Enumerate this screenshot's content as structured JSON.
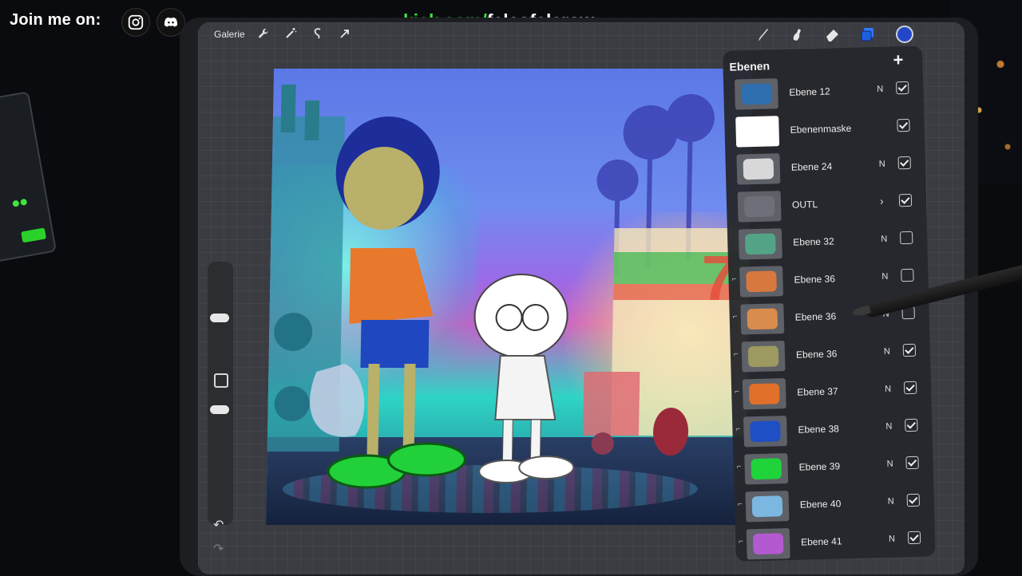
{
  "overlay": {
    "join_text": "Join me on:",
    "socials": [
      {
        "icon": "instagram-icon"
      },
      {
        "icon": "discord-icon"
      }
    ],
    "url_green": "kick.com/",
    "url_white": "falcofalcrow"
  },
  "toolbar": {
    "gallery_label": "Galerie",
    "left_tools": [
      "wrench-icon",
      "magic-wand-icon",
      "selection-icon",
      "transform-arrow-icon"
    ],
    "right_tools": [
      "brush-icon",
      "smudge-icon",
      "eraser-icon",
      "layers-icon"
    ],
    "current_color": "#2447c9"
  },
  "layers": {
    "title": "Ebenen",
    "add_symbol": "+",
    "items": [
      {
        "name": "Ebene 12",
        "mode": "N",
        "visible": true,
        "thumb": "#2f6fb0"
      },
      {
        "name": "Ebenenmaske",
        "mode": "",
        "visible": true,
        "thumb": "#ffffff",
        "selected": true
      },
      {
        "name": "Ebene 24",
        "mode": "N",
        "visible": true,
        "thumb": "#d8d8d8"
      },
      {
        "name": "OUTL",
        "mode": "",
        "visible": true,
        "thumb": "#6d7079",
        "group": true
      },
      {
        "name": "Ebene 32",
        "mode": "N",
        "visible": false,
        "thumb": "#53a487"
      },
      {
        "name": "Ebene 36",
        "mode": "N",
        "visible": false,
        "thumb": "#d7783e",
        "clip": true
      },
      {
        "name": "Ebene 36",
        "mode": "N",
        "visible": false,
        "thumb": "#d88c4d",
        "clip": true
      },
      {
        "name": "Ebene 36",
        "mode": "N",
        "visible": true,
        "thumb": "#9c9a61",
        "clip": true
      },
      {
        "name": "Ebene 37",
        "mode": "N",
        "visible": true,
        "thumb": "#e0702a",
        "clip": true
      },
      {
        "name": "Ebene 38",
        "mode": "N",
        "visible": true,
        "thumb": "#1f4fc4",
        "clip": true
      },
      {
        "name": "Ebene 39",
        "mode": "N",
        "visible": true,
        "thumb": "#1fd33a",
        "clip": true
      },
      {
        "name": "Ebene 40",
        "mode": "N",
        "visible": true,
        "thumb": "#7bb7e0",
        "clip": true
      },
      {
        "name": "Ebene 41",
        "mode": "N",
        "visible": true,
        "thumb": "#b45ad0",
        "clip": true
      }
    ]
  },
  "sidebar": {
    "undo_symbol": "↶",
    "redo_symbol": "↷"
  }
}
